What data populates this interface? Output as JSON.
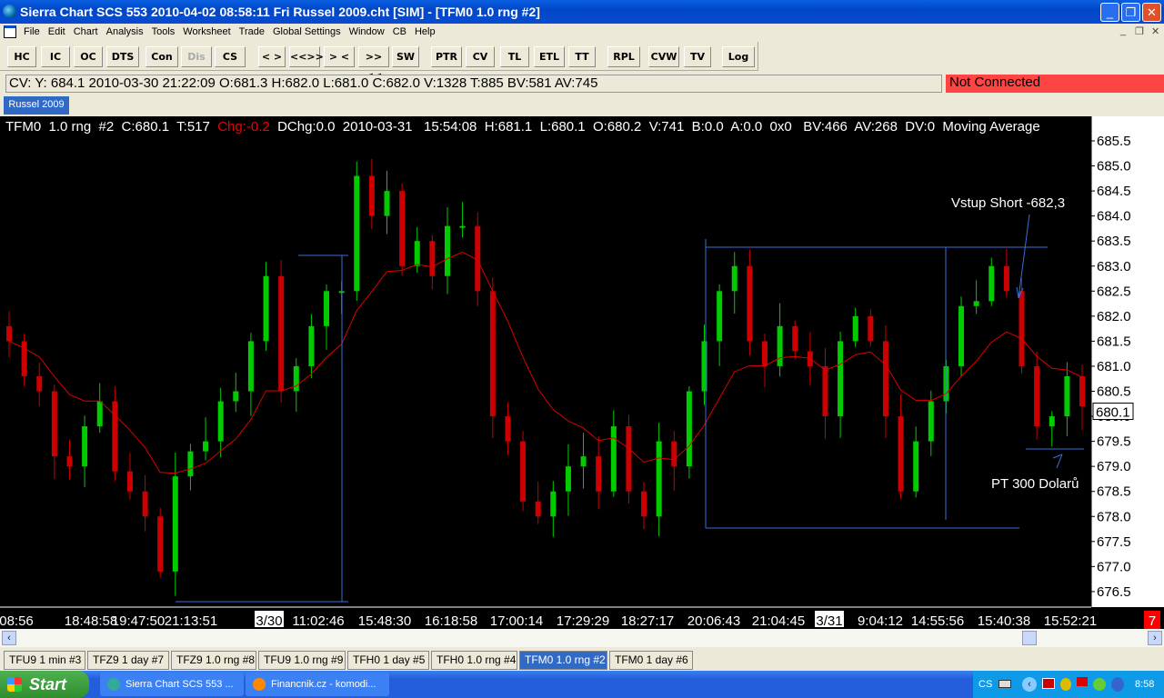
{
  "window": {
    "title": "Sierra Chart SCS 553  2010-04-02  08:58:11  Fri   Russel 2009.cht [SIM] - [TFM0  1.0 rng  #2]"
  },
  "menu": [
    "File",
    "Edit",
    "Chart",
    "Analysis",
    "Tools",
    "Worksheet",
    "Trade",
    "Global Settings",
    "Window",
    "CB",
    "Help"
  ],
  "toolbar": [
    "HC",
    "IC",
    "OC",
    "DTS",
    "Con",
    "Dis",
    "CS",
    "< >",
    "<<>>",
    "> <",
    ">><<",
    "SW",
    "PTR",
    "CV",
    "TL",
    "ETL",
    "TT",
    "RPL",
    "CVW",
    "TV",
    "Log"
  ],
  "cv_line": "CV: Y: 684.1  2010-03-30  21:22:09  O:681.3  H:682.0  L:681.0  C:682.0  V:1328  T:885  BV:581  AV:745",
  "connection_status": "Not Connected",
  "chartbook_tab": "Russel 2009",
  "chart": {
    "info_pre": "TFM0  1.0 rng  #2  C:680.1  T:517  ",
    "info_chg": "Chg:-0.2",
    "info_post": "  DChg:0.0  2010-03-31   15:54:08  H:681.1  L:680.1  O:680.2  V:741  B:0.0  A:0.0  0x0   BV:466  AV:268  DV:0  Moving Average",
    "current_price": "680.1",
    "price_labels": [
      "685.5",
      "685.0",
      "684.5",
      "684.0",
      "683.5",
      "683.0",
      "682.5",
      "682.0",
      "681.5",
      "681.0",
      "680.5",
      "680.0",
      "679.5",
      "679.0",
      "678.5",
      "678.0",
      "677.5",
      "677.0",
      "676.5"
    ],
    "time_labels": [
      "08:56",
      "18:48:58",
      "19:47:50",
      "21:13:51",
      "3/30",
      "11:02:46",
      "15:48:30",
      "16:18:58",
      "17:00:14",
      "17:29:29",
      "18:27:17",
      "20:06:43",
      "21:04:45",
      "3/31",
      "9:04:12",
      "14:55:56",
      "15:40:38",
      "15:52:21"
    ],
    "annotation_entry": "Vstup Short -682,3",
    "annotation_target": "PT 300 Dolarů",
    "corner_badge": "7",
    "closes": [
      681.5,
      680.8,
      680.5,
      679.2,
      679.0,
      679.8,
      680.3,
      678.9,
      678.5,
      678.0,
      676.9,
      678.8,
      679.3,
      679.5,
      680.3,
      680.5,
      681.5,
      682.8,
      680.5,
      681.0,
      681.8,
      682.5,
      682.5,
      684.8,
      684.0,
      684.5,
      683.0,
      683.5,
      682.8,
      683.8,
      683.8,
      682.5,
      680.0,
      679.5,
      678.3,
      678.0,
      678.5,
      679.0,
      679.2,
      678.5,
      679.8,
      678.5,
      678.0,
      679.5,
      679.0,
      680.5,
      681.5,
      682.5,
      683.0,
      681.5,
      681.0,
      681.8,
      681.3,
      681.0,
      680.0,
      681.5,
      682.0,
      681.5,
      680.0,
      678.5,
      679.5,
      680.3,
      681.0,
      682.2,
      682.3,
      683.0,
      682.5,
      681.0,
      679.8,
      680.0,
      680.8,
      680.2
    ],
    "colors": {
      "up": "#00cc00",
      "down": "#cc0000",
      "ma": "#dd0000",
      "drawing": "#3a6fd8"
    }
  },
  "chart_tabs": [
    "TFU9 1 min  #3",
    "TFZ9 1 day  #7",
    "TFZ9 1.0 rng  #8",
    "TFU9 1.0 rng  #9",
    "TFH0 1 day  #5",
    "TFH0 1.0 rng  #4",
    "TFM0 1.0 rng  #2",
    "TFM0 1 day  #6"
  ],
  "taskbar": {
    "start": "Start",
    "tasks": [
      "Sierra Chart SCS 553 ...",
      "Financnik.cz - komodi..."
    ],
    "lang": "CS",
    "clock": "8:58"
  }
}
